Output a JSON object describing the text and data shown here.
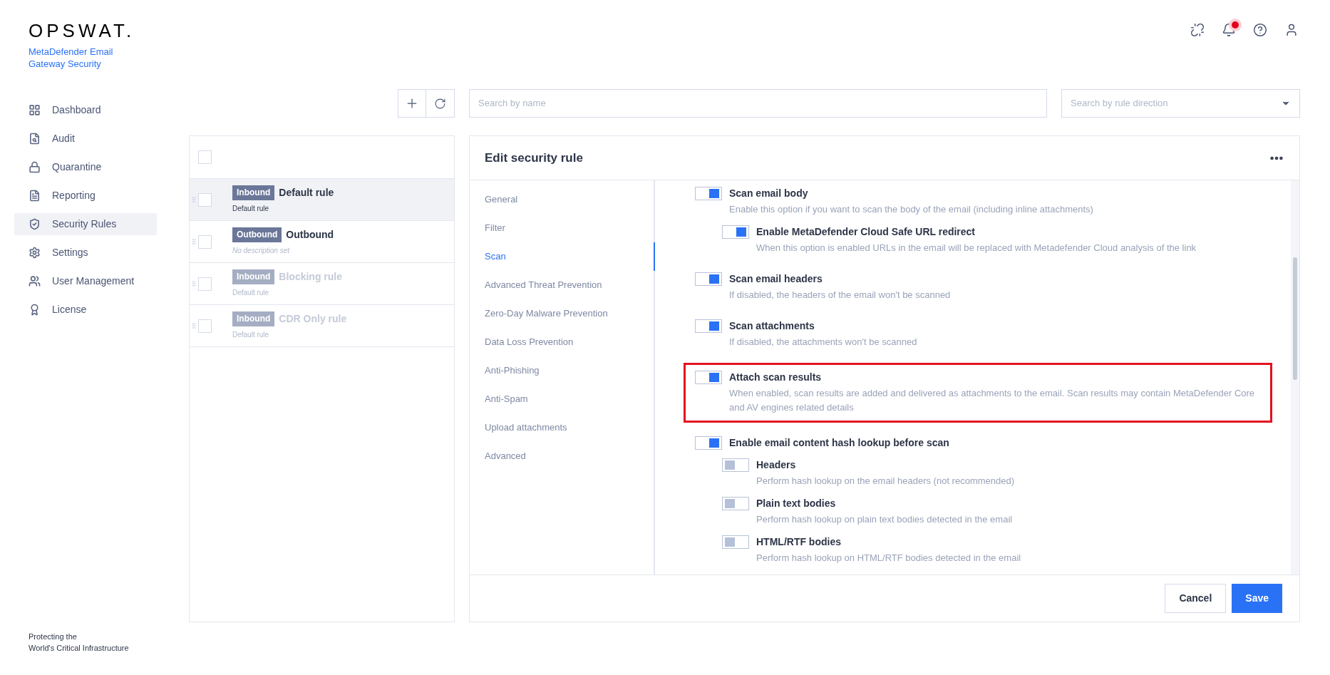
{
  "brand": {
    "logo": "OPSWAT.",
    "product": "MetaDefender Email Gateway Security"
  },
  "nav": [
    {
      "label": "Dashboard",
      "selected": false
    },
    {
      "label": "Audit",
      "selected": false
    },
    {
      "label": "Quarantine",
      "selected": false
    },
    {
      "label": "Reporting",
      "selected": false
    },
    {
      "label": "Security Rules",
      "selected": true
    },
    {
      "label": "Settings",
      "selected": false
    },
    {
      "label": "User Management",
      "selected": false
    },
    {
      "label": "License",
      "selected": false
    }
  ],
  "footer": [
    "Protecting the",
    "World's Critical Infrastructure"
  ],
  "header_icons": [
    {
      "badge": false
    },
    {
      "badge": true
    },
    {
      "badge": false
    },
    {
      "badge": false
    }
  ],
  "select_all": {
    "checked": false
  },
  "search": {
    "placeholder": "Search by name"
  },
  "direction": {
    "placeholder": "Search by rule direction"
  },
  "rules": [
    {
      "direction": "Inbound",
      "name": "Default rule",
      "description": "Default rule",
      "selected": true,
      "enabled": true,
      "italic": false,
      "checked": false
    },
    {
      "direction": "Outbound",
      "name": "Outbound",
      "description": "No description set",
      "selected": false,
      "enabled": true,
      "italic": true,
      "checked": false
    },
    {
      "direction": "Inbound",
      "name": "Blocking rule",
      "description": "Default rule",
      "selected": false,
      "enabled": false,
      "italic": false,
      "checked": false
    },
    {
      "direction": "Inbound",
      "name": "CDR Only rule",
      "description": "Default rule",
      "selected": false,
      "enabled": false,
      "italic": false,
      "checked": false
    }
  ],
  "editor": {
    "title": "Edit security rule",
    "sections": [
      {
        "label": "General",
        "selected": false
      },
      {
        "label": "Filter",
        "selected": false
      },
      {
        "label": "Scan",
        "selected": true
      },
      {
        "label": "Advanced Threat Prevention",
        "selected": false
      },
      {
        "label": "Zero-Day Malware Prevention",
        "selected": false
      },
      {
        "label": "Data Loss Prevention",
        "selected": false
      },
      {
        "label": "Anti-Phishing",
        "selected": false
      },
      {
        "label": "Anti-Spam",
        "selected": false
      },
      {
        "label": "Upload attachments",
        "selected": false
      },
      {
        "label": "Advanced",
        "selected": false
      }
    ],
    "options": [
      {
        "title": "Scan email body",
        "description": "Enable this option if you want to scan the body of the email (including inline attachments)",
        "on": true,
        "highlighted": false,
        "children": [
          {
            "title": "Enable MetaDefender Cloud Safe URL redirect",
            "description": "When this option is enabled URLs in the email will be replaced with Metadefender Cloud analysis of the link",
            "on": true
          }
        ]
      },
      {
        "title": "Scan email headers",
        "description": "If disabled, the headers of the email won't be scanned",
        "on": true,
        "highlighted": false
      },
      {
        "title": "Scan attachments",
        "description": "If disabled, the attachments won't be scanned",
        "on": true,
        "highlighted": false
      },
      {
        "title": "Attach scan results",
        "description": "When enabled, scan results are added and delivered as attachments to the email. Scan results may contain MetaDefender Core and AV engines related details",
        "on": true,
        "highlighted": true
      },
      {
        "title": "Enable email content hash lookup before scan",
        "on": true,
        "highlighted": false,
        "children": [
          {
            "title": "Headers",
            "description": "Perform hash lookup on the email headers (not recommended)",
            "on": false
          },
          {
            "title": "Plain text bodies",
            "description": "Perform hash lookup on plain text bodies detected in the email",
            "on": false
          },
          {
            "title": "HTML/RTF bodies",
            "description": "Perform hash lookup on HTML/RTF bodies detected in the email",
            "on": false
          }
        ]
      }
    ],
    "buttons": [
      {
        "label": "Cancel",
        "kind": "secondary"
      },
      {
        "label": "Save",
        "kind": "primary"
      }
    ]
  }
}
